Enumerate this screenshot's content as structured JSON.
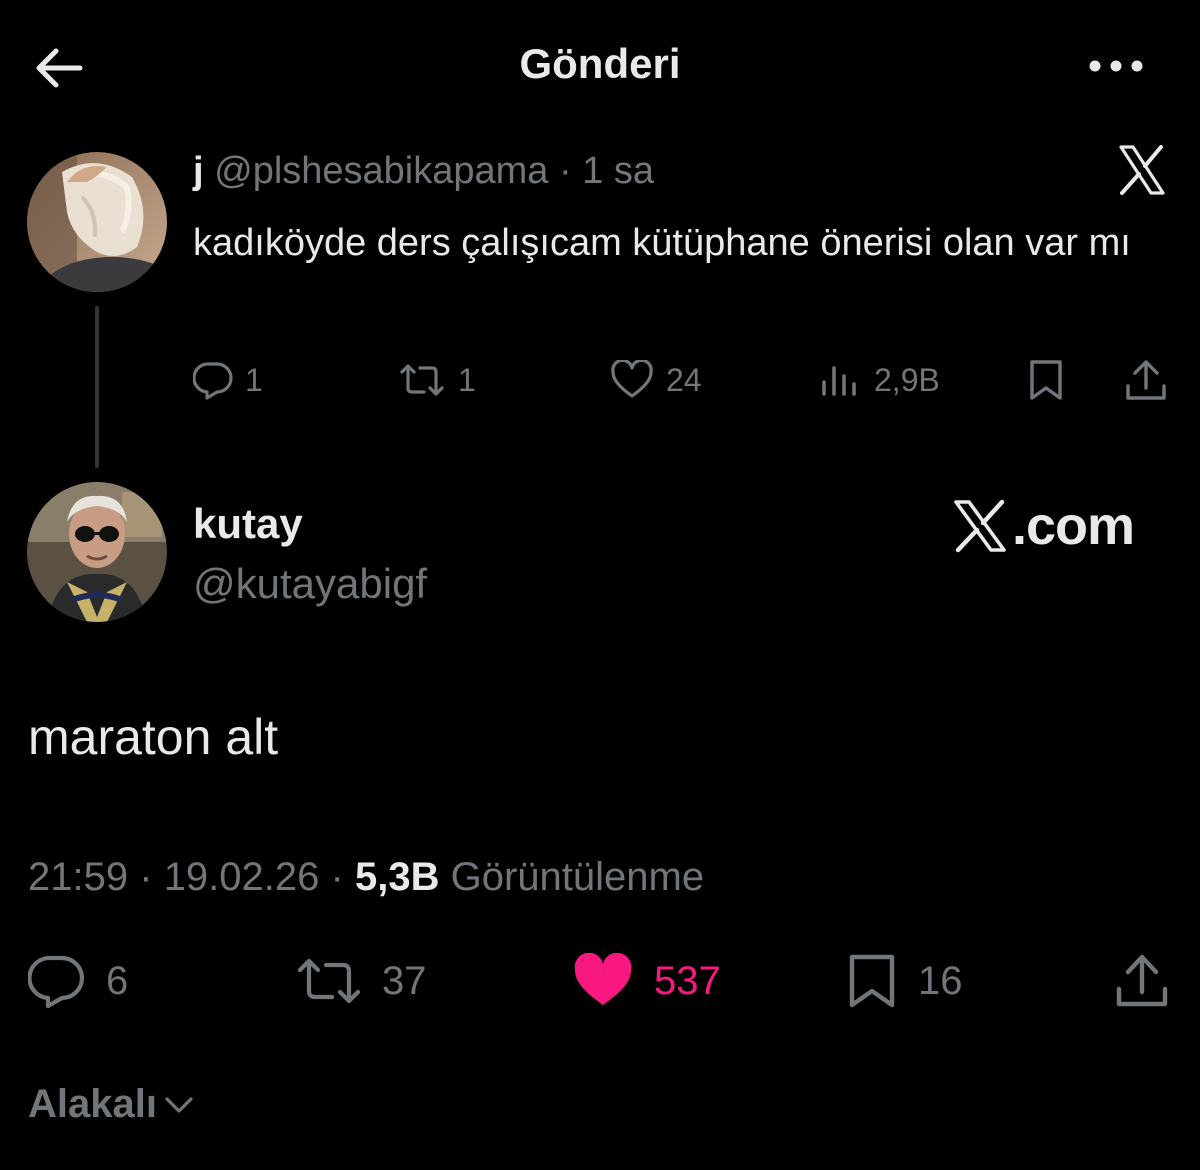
{
  "header": {
    "title": "Gönderi"
  },
  "parent_tweet": {
    "name": "j",
    "handle": "@plshesabikapama",
    "separator": "·",
    "time": "1 sa",
    "text": "kadıköyde ders çalışıcam kütüphane önerisi olan var mı",
    "actions": {
      "replies": "1",
      "reposts": "1",
      "likes": "24",
      "views": "2,9B"
    }
  },
  "main_tweet": {
    "name": "kutay",
    "handle": "@kutayabigf",
    "watermark": ".com",
    "text": "maraton alt",
    "time": "21:59",
    "separator": "·",
    "date": "19.02.26",
    "views_count": "5,3B",
    "views_label": "Görüntülenme",
    "actions": {
      "replies": "6",
      "reposts": "37",
      "likes": "537",
      "bookmarks": "16"
    }
  },
  "sort": {
    "label": "Alakalı"
  },
  "colors": {
    "background": "#000000",
    "text": "#e7e9ea",
    "muted": "#71767b",
    "like": "#f91880",
    "thread_line": "#333639"
  },
  "icons": [
    "back-arrow-icon",
    "more-icon",
    "x-logo-icon",
    "reply-icon",
    "repost-icon",
    "like-icon",
    "views-icon",
    "bookmark-icon",
    "share-icon",
    "chevron-down-icon"
  ]
}
